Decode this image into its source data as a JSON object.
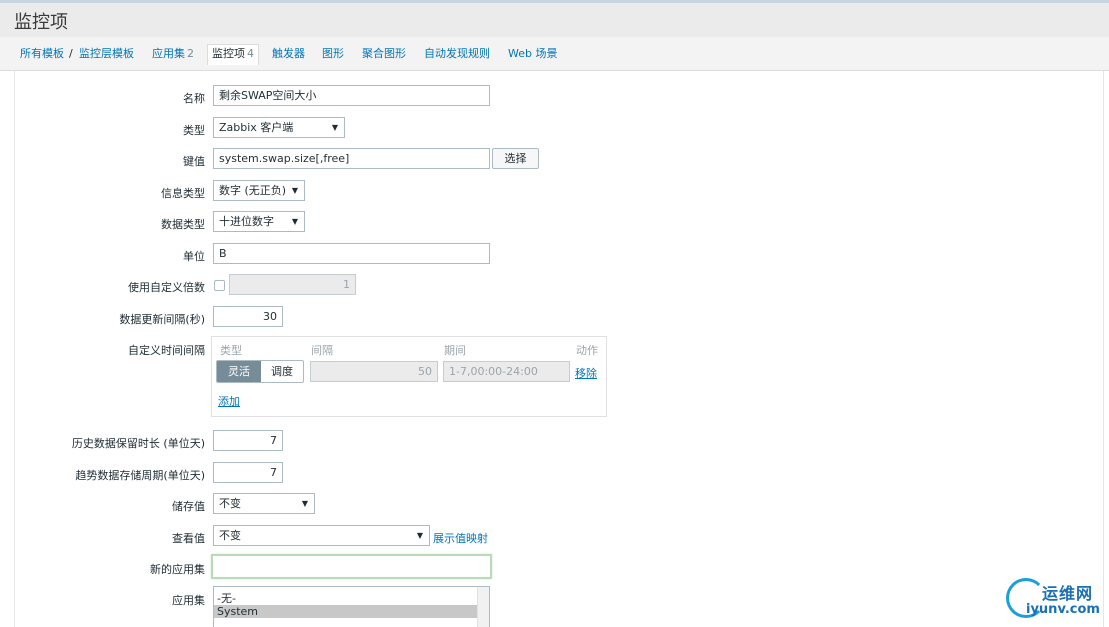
{
  "header": {
    "title": "监控项"
  },
  "nav": {
    "items": [
      {
        "label": "所有模板"
      },
      {
        "label": "/"
      },
      {
        "label": "监控层模板"
      },
      {
        "label": "应用集",
        "count": "2"
      },
      {
        "label": "监控项",
        "count": "4"
      },
      {
        "label": "触发器"
      },
      {
        "label": "图形"
      },
      {
        "label": "聚合图形"
      },
      {
        "label": "自动发现规则"
      },
      {
        "label": "Web 场景"
      }
    ]
  },
  "form": {
    "name": {
      "label": "名称",
      "value": "剩余SWAP空间大小"
    },
    "type": {
      "label": "类型",
      "value": "Zabbix 客户端"
    },
    "key": {
      "label": "键值",
      "value": "system.swap.size[,free]",
      "button": "选择"
    },
    "info_type": {
      "label": "信息类型",
      "value": "数字 (无正负)"
    },
    "data_type": {
      "label": "数据类型",
      "value": "十进位数字"
    },
    "units": {
      "label": "单位",
      "value": "B"
    },
    "multiplier": {
      "label": "使用自定义倍数",
      "value": "1"
    },
    "update_interval": {
      "label": "数据更新间隔(秒)",
      "value": "30"
    },
    "custom_intervals": {
      "label": "自定义时间间隔",
      "headers": {
        "type": "类型",
        "interval": "间隔",
        "period": "期间",
        "action": "动作"
      },
      "mode_flexible": "灵活",
      "mode_scheduling": "调度",
      "interval_value": "50",
      "period_value": "1-7,00:00-24:00",
      "remove": "移除",
      "add": "添加"
    },
    "history": {
      "label": "历史数据保留时长 (单位天)",
      "value": "7"
    },
    "trends": {
      "label": "趋势数据存储周期(单位天)",
      "value": "7"
    },
    "store_value": {
      "label": "储存值",
      "value": "不变"
    },
    "show_value": {
      "label": "查看值",
      "value": "不变",
      "link": "展示值映射"
    },
    "new_application": {
      "label": "新的应用集",
      "value": ""
    },
    "applications": {
      "label": "应用集",
      "options": [
        "-无-",
        "System"
      ]
    }
  },
  "watermark": {
    "cn": "运维网",
    "en": "iyunv.com"
  },
  "colors": {
    "link": "#0275b8",
    "active_segment": "#768d99",
    "focus_border": "#b9dbb7"
  }
}
